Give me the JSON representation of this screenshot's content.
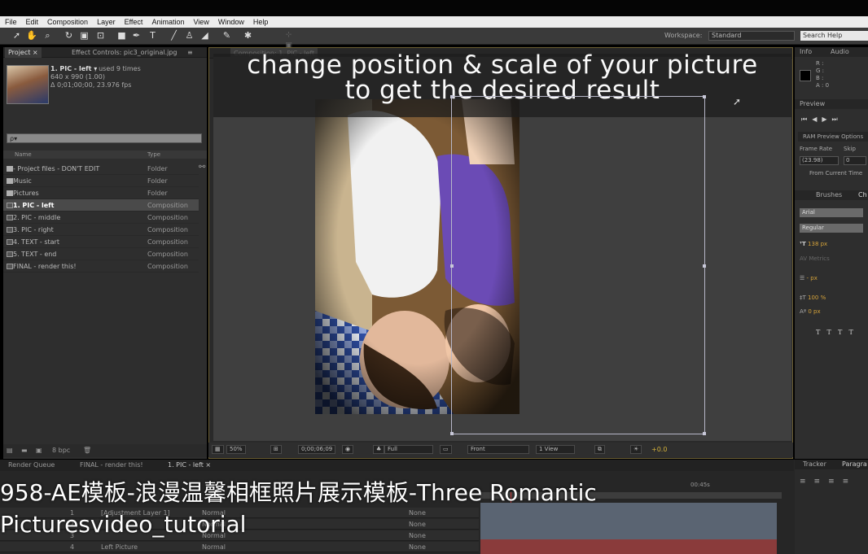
{
  "menu": [
    "File",
    "Edit",
    "Composition",
    "Layer",
    "Effect",
    "Animation",
    "View",
    "Window",
    "Help"
  ],
  "workspace": {
    "label": "Workspace:",
    "value": "Standard"
  },
  "search_help": "Search Help",
  "project_panel": {
    "tabs": [
      "Project ×",
      "Effect Controls: pic3_original.jpg"
    ],
    "item_name": "1. PIC - left ▾",
    "used": ", used 9 times",
    "dims": "640 x 990 (1.00)",
    "duration": "Δ 0;01;00;00, 23.976 fps",
    "search_placeholder": "ρ▾",
    "columns": {
      "name": "Name",
      "type": "Type"
    },
    "items": [
      {
        "name": "- Project files - DON'T EDIT",
        "type": "Folder",
        "kind": "folder"
      },
      {
        "name": "Music",
        "type": "Folder",
        "kind": "folder"
      },
      {
        "name": "Pictures",
        "type": "Folder",
        "kind": "folder"
      },
      {
        "name": "1. PIC - left",
        "type": "Composition",
        "kind": "comp",
        "selected": true
      },
      {
        "name": "2. PIC - middle",
        "type": "Composition",
        "kind": "comp"
      },
      {
        "name": "3. PIC - right",
        "type": "Composition",
        "kind": "comp"
      },
      {
        "name": "4. TEXT - start",
        "type": "Composition",
        "kind": "comp"
      },
      {
        "name": "5. TEXT - end",
        "type": "Composition",
        "kind": "comp"
      },
      {
        "name": "FINAL - render this!",
        "type": "Composition",
        "kind": "comp"
      }
    ],
    "bpc": "8 bpc"
  },
  "composition": {
    "tab": "Composition: 1. PIC - left",
    "caption_line1": "change position & scale of your picture",
    "caption_line2": "to get the desired result",
    "zoom": "50%",
    "timecode": "0;00;06;09",
    "resolution": "Full",
    "view": "Front",
    "views": "1 View",
    "exposure": "+0.0"
  },
  "right": {
    "info_tab": "Info",
    "audio_tab": "Audio",
    "rgb": [
      "R :",
      "G :",
      "B :",
      "A : 0"
    ],
    "preview_tab": "Preview",
    "ram_preview": "RAM Preview Options",
    "frame_rate_label": "Frame Rate",
    "skip_label": "Skip",
    "frame_rate": "(23.98)",
    "skip": "0",
    "from_current": "From Current Time",
    "brushes_tab": "Brushes",
    "char_tab": "Ch",
    "font": "Arial",
    "style": "Regular",
    "size": "138 px",
    "tracking": "Metrics",
    "leading": "- px",
    "scale": "100 %",
    "baseline": "0 px",
    "tracker_tab": "Tracker",
    "paragraph_tab": "Paragra"
  },
  "timeline": {
    "tabs": [
      "Render Queue",
      "FINAL - render this!",
      "1. PIC - left ×"
    ],
    "time_marker": "00:45s",
    "layers": [
      {
        "num": "1",
        "name": "[Adjustment Layer 1]",
        "mode": "Normal",
        "parent": "None"
      },
      {
        "num": "2",
        "name": "",
        "mode": "Normal",
        "parent": "None"
      },
      {
        "num": "3",
        "name": "",
        "mode": "Normal",
        "parent": "None"
      },
      {
        "num": "4",
        "name": "Left Picture",
        "mode": "Normal",
        "parent": "None"
      }
    ]
  },
  "subtitle": {
    "line1": "958-AE模板-浪漫温馨相框照片展示模板-Three Romantic",
    "line2": "Picturesvideo_tutorial"
  }
}
